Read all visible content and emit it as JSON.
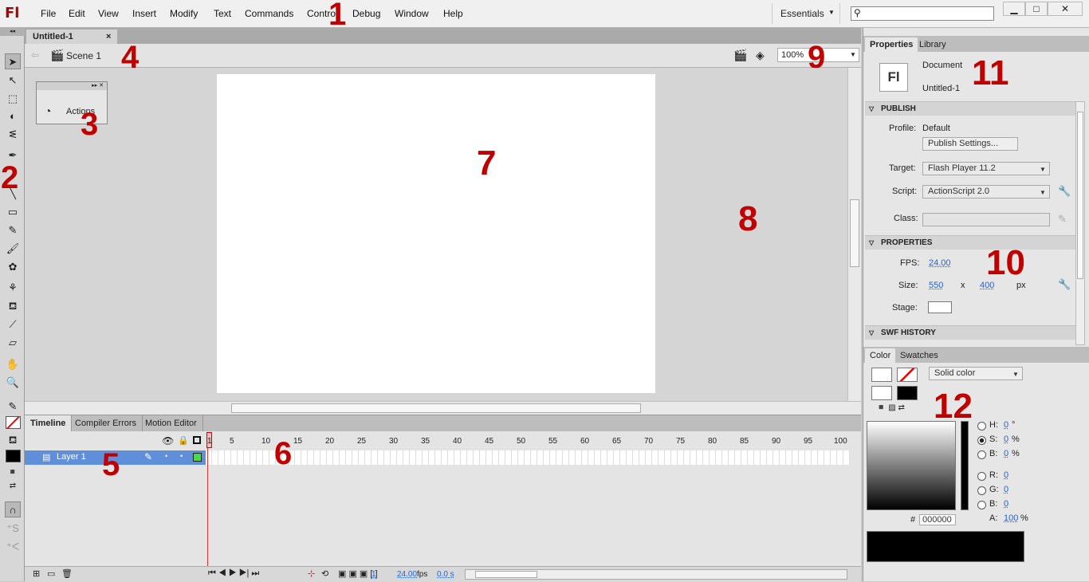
{
  "menu": {
    "logo": "Fl",
    "items": [
      "File",
      "Edit",
      "View",
      "Insert",
      "Modify",
      "Text",
      "Commands",
      "Control",
      "Debug",
      "Window",
      "Help"
    ],
    "workspace": "Essentials",
    "search_placeholder": ""
  },
  "doc": {
    "tab_label": "Untitled-1",
    "scene_label": "Scene 1",
    "zoom": "100%"
  },
  "floating_panel": {
    "button_label": "Actions"
  },
  "timeline": {
    "tabs": [
      "Timeline",
      "Compiler Errors",
      "Motion Editor"
    ],
    "layer_name": "Layer 1",
    "frame_numbers": [
      "1",
      "5",
      "10",
      "15",
      "20",
      "25",
      "30",
      "35",
      "40",
      "45",
      "50",
      "55",
      "60",
      "65",
      "70",
      "75",
      "80",
      "85",
      "90",
      "95",
      "100"
    ],
    "current_frame": "1",
    "fps": "24.00",
    "fps_unit": "fps",
    "elapsed": "0.0 s"
  },
  "properties": {
    "tabs": [
      "Properties",
      "Library"
    ],
    "doc_icon": "Fl",
    "doc_type": "Document",
    "doc_name": "Untitled-1",
    "publish_header": "PUBLISH",
    "profile_label": "Profile:",
    "profile_value": "Default",
    "publish_settings_btn": "Publish Settings...",
    "target_label": "Target:",
    "target_value": "Flash Player 11.2",
    "script_label": "Script:",
    "script_value": "ActionScript 2.0",
    "class_label": "Class:",
    "properties_header": "PROPERTIES",
    "fps_label": "FPS:",
    "fps_value": "24.00",
    "size_label": "Size:",
    "width": "550",
    "x": "x",
    "height": "400",
    "px": "px",
    "stage_label": "Stage:",
    "swf_header": "SWF HISTORY"
  },
  "color": {
    "tabs": [
      "Color",
      "Swatches"
    ],
    "mode": "Solid color",
    "h_label": "H:",
    "h_value": "0",
    "h_unit": "°",
    "s_label": "S:",
    "s_value": "0",
    "s_unit": "%",
    "b_label": "B:",
    "b_value": "0",
    "b_unit": "%",
    "r_label": "R:",
    "r_value": "0",
    "g_label": "G:",
    "g_value": "0",
    "bb_label": "B:",
    "bb_value": "0",
    "a_label": "A:",
    "a_value": "100",
    "a_unit": "%",
    "hash": "#",
    "hex": "000000"
  },
  "annotations": [
    "1",
    "2",
    "3",
    "4",
    "5",
    "6",
    "7",
    "8",
    "9",
    "10",
    "11",
    "12"
  ],
  "colors": {
    "accent_red": "#c00000",
    "selection_blue": "#5e8fd8",
    "link_blue": "#2b62c8"
  }
}
